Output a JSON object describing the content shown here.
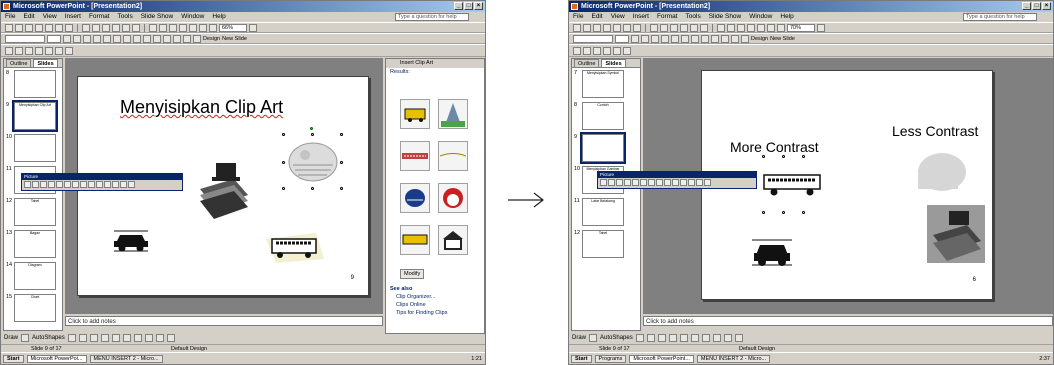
{
  "left": {
    "window_title": "Microsoft PowerPoint - [Presentation2]",
    "menu": [
      "File",
      "Edit",
      "View",
      "Insert",
      "Format",
      "Tools",
      "Slide Show",
      "Window",
      "Help"
    ],
    "help_placeholder": "Type a question for help",
    "zoom": "66%",
    "design_button": "Design",
    "new_slide_button": "New Slide",
    "pane_tabs": [
      "Outline",
      "Slides"
    ],
    "thumbnails": [
      {
        "num": "8",
        "caption": ""
      },
      {
        "num": "9",
        "caption": "Menyisipkan Clip Art"
      },
      {
        "num": "10",
        "caption": ""
      },
      {
        "num": "11",
        "caption": ""
      },
      {
        "num": "12",
        "caption": "Tabel"
      },
      {
        "num": "13",
        "caption": "Bagan"
      },
      {
        "num": "14",
        "caption": "Diagram"
      },
      {
        "num": "15",
        "caption": "Chart"
      }
    ],
    "slide_title": "Menyisipkan Clip Art",
    "slide_page_marker": "9",
    "floatbar_title": "Picture",
    "notes_placeholder": "Click to add notes",
    "draw_label": "Draw",
    "autoshapes_label": "AutoShapes",
    "status_slide": "Slide 9 of 17",
    "status_design": "Default Design",
    "taskpane_title": "Insert Clip Art",
    "taskpane_results": "Results:",
    "modify_button": "Modify",
    "see_also": "See also",
    "see_also_links": [
      "Clip Organizer...",
      "Clips Online",
      "Tips for Finding Clips"
    ],
    "taskbar": {
      "start": "Start",
      "tasks": [
        "Microsoft PowerPoi...",
        "MENU INSERT 2 - Micro..."
      ],
      "clock": "1:21"
    }
  },
  "right": {
    "window_title": "Microsoft PowerPoint - [Presentation2]",
    "menu": [
      "File",
      "Edit",
      "View",
      "Insert",
      "Format",
      "Tools",
      "Slide Show",
      "Window",
      "Help"
    ],
    "help_placeholder": "Type a question for help",
    "zoom": "70%",
    "design_button": "Design",
    "new_slide_button": "New Slide",
    "pane_tabs": [
      "Outline",
      "Slides"
    ],
    "thumbnails": [
      {
        "num": "7",
        "caption": "Menyisipkan Symbol"
      },
      {
        "num": "8",
        "caption": "Contoh"
      },
      {
        "num": "9",
        "caption": ""
      },
      {
        "num": "10",
        "caption": "Menyisipkan Gambar"
      },
      {
        "num": "11",
        "caption": "Latar Belakang"
      },
      {
        "num": "12",
        "caption": "Tabel"
      }
    ],
    "slide_title_left": "More Contrast",
    "slide_title_right": "Less Contrast",
    "slide_page_marker": "6",
    "floatbar_title": "Picture",
    "notes_placeholder": "Click to add notes",
    "draw_label": "Draw",
    "autoshapes_label": "AutoShapes",
    "status_slide": "Slide 9 of 17",
    "status_design": "Default Design",
    "taskbar": {
      "start": "Start",
      "tasks": [
        "Programs",
        "Microsoft PowerPoint...",
        "MENU INSERT 2 - Micro..."
      ],
      "clock": "2:37"
    }
  },
  "colors": {
    "titlebar_start": "#0a246a",
    "titlebar_end": "#a6caf0",
    "chrome": "#d4d0c8",
    "workspace": "#808080"
  }
}
